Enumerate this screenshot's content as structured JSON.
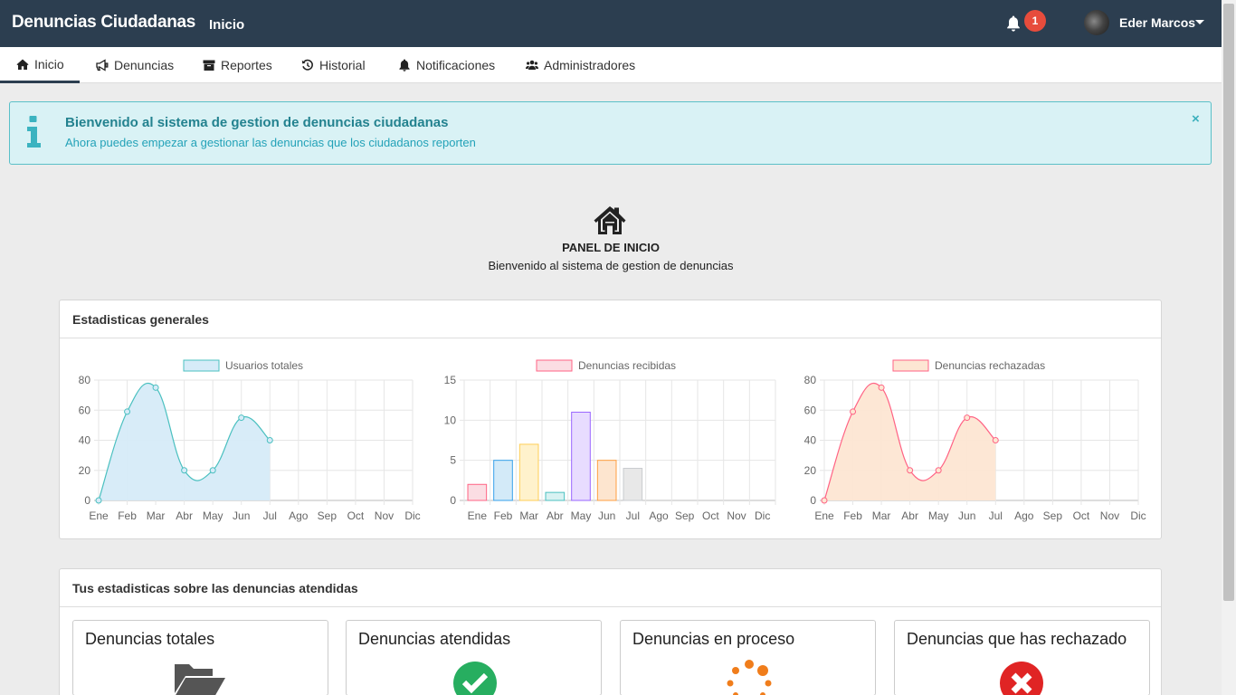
{
  "navbar": {
    "brand": "Denuncias Ciudadanas",
    "section": "Inicio",
    "notification_count": "1",
    "user_name": "Eder Marcos",
    "bg_color": "#2c3e50"
  },
  "tabs": [
    {
      "label": "Inicio",
      "icon": "home-icon",
      "active": true
    },
    {
      "label": "Denuncias",
      "icon": "bullhorn-icon"
    },
    {
      "label": "Reportes",
      "icon": "archive-icon"
    },
    {
      "label": "Historial",
      "icon": "history-icon"
    },
    {
      "label": "Notificaciones",
      "icon": "bell-icon"
    },
    {
      "label": "Administradores",
      "icon": "users-icon"
    }
  ],
  "alert": {
    "title": "Bienvenido al sistema de gestion de denuncias ciudadanas",
    "text": "Ahora puedes empezar a gestionar las denuncias que los ciudadanos reporten",
    "close": "×"
  },
  "panel": {
    "title": "PANEL DE INICIO",
    "subtitle": "Bienvenido al sistema de gestion de denuncias"
  },
  "stats_card": {
    "title": "Estadisticas generales"
  },
  "chart_data": [
    {
      "type": "area",
      "legend": "Usuarios totales",
      "categories": [
        "Ene",
        "Feb",
        "Mar",
        "Abr",
        "May",
        "Jun",
        "Jul",
        "Ago",
        "Sep",
        "Oct",
        "Nov",
        "Dic"
      ],
      "values": [
        0,
        59,
        75,
        20,
        20,
        55,
        40
      ],
      "ylim": [
        0,
        80
      ],
      "yticks": [
        0,
        20,
        40,
        60,
        80
      ],
      "stroke": "#4bc0c0",
      "fill": "#d6ebf8"
    },
    {
      "type": "bar",
      "legend": "Denuncias recibidas",
      "categories": [
        "Ene",
        "Feb",
        "Mar",
        "Abr",
        "May",
        "Jun",
        "Jul",
        "Ago",
        "Sep",
        "Oct",
        "Nov",
        "Dic"
      ],
      "values": [
        2,
        5,
        7,
        1,
        11,
        5,
        4
      ],
      "ylim": [
        0,
        15
      ],
      "yticks": [
        0,
        5,
        10,
        15
      ],
      "bar_fills": [
        "#fbdde3",
        "#d3eaf8",
        "#fff2cc",
        "#d8f2f2",
        "#e8dcff",
        "#fde5cf",
        "#e8e8e8"
      ],
      "bar_strokes": [
        "#ff6384",
        "#36a2eb",
        "#ffce56",
        "#4bc0c0",
        "#9966ff",
        "#ff9f40",
        "#c9cbcf"
      ],
      "legend_fill": "#fbdde3",
      "legend_stroke": "#ff6384"
    },
    {
      "type": "area",
      "legend": "Denuncias rechazadas",
      "categories": [
        "Ene",
        "Feb",
        "Mar",
        "Abr",
        "May",
        "Jun",
        "Jul",
        "Ago",
        "Sep",
        "Oct",
        "Nov",
        "Dic"
      ],
      "values": [
        0,
        59,
        75,
        20,
        20,
        55,
        40
      ],
      "ylim": [
        0,
        80
      ],
      "yticks": [
        0,
        20,
        40,
        60,
        80
      ],
      "stroke": "#ff6384",
      "fill": "#fde6d3"
    }
  ],
  "attended_card": {
    "title": "Tus estadisticas sobre las denuncias atendidas"
  },
  "mini_cards": [
    {
      "title": "Denuncias totales",
      "icon": "folder-open-icon"
    },
    {
      "title": "Denuncias atendidas",
      "icon": "check-circle-icon"
    },
    {
      "title": "Denuncias en proceso",
      "icon": "spinner-icon"
    },
    {
      "title": "Denuncias que has rechazado",
      "icon": "times-circle-icon"
    }
  ]
}
